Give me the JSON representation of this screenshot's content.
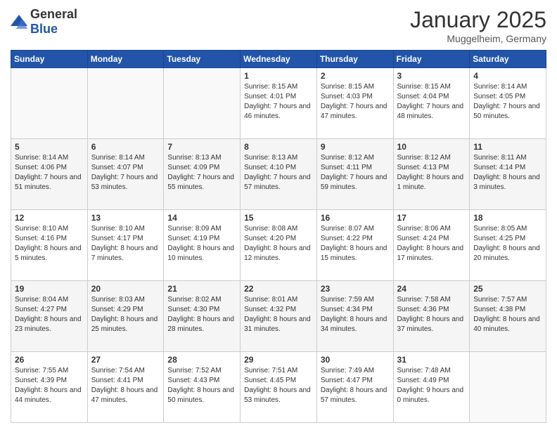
{
  "header": {
    "logo_general": "General",
    "logo_blue": "Blue",
    "month_title": "January 2025",
    "location": "Muggelheim, Germany"
  },
  "days_of_week": [
    "Sunday",
    "Monday",
    "Tuesday",
    "Wednesday",
    "Thursday",
    "Friday",
    "Saturday"
  ],
  "weeks": [
    [
      {
        "day": "",
        "info": ""
      },
      {
        "day": "",
        "info": ""
      },
      {
        "day": "",
        "info": ""
      },
      {
        "day": "1",
        "info": "Sunrise: 8:15 AM\nSunset: 4:01 PM\nDaylight: 7 hours and 46 minutes."
      },
      {
        "day": "2",
        "info": "Sunrise: 8:15 AM\nSunset: 4:03 PM\nDaylight: 7 hours and 47 minutes."
      },
      {
        "day": "3",
        "info": "Sunrise: 8:15 AM\nSunset: 4:04 PM\nDaylight: 7 hours and 48 minutes."
      },
      {
        "day": "4",
        "info": "Sunrise: 8:14 AM\nSunset: 4:05 PM\nDaylight: 7 hours and 50 minutes."
      }
    ],
    [
      {
        "day": "5",
        "info": "Sunrise: 8:14 AM\nSunset: 4:06 PM\nDaylight: 7 hours and 51 minutes."
      },
      {
        "day": "6",
        "info": "Sunrise: 8:14 AM\nSunset: 4:07 PM\nDaylight: 7 hours and 53 minutes."
      },
      {
        "day": "7",
        "info": "Sunrise: 8:13 AM\nSunset: 4:09 PM\nDaylight: 7 hours and 55 minutes."
      },
      {
        "day": "8",
        "info": "Sunrise: 8:13 AM\nSunset: 4:10 PM\nDaylight: 7 hours and 57 minutes."
      },
      {
        "day": "9",
        "info": "Sunrise: 8:12 AM\nSunset: 4:11 PM\nDaylight: 7 hours and 59 minutes."
      },
      {
        "day": "10",
        "info": "Sunrise: 8:12 AM\nSunset: 4:13 PM\nDaylight: 8 hours and 1 minute."
      },
      {
        "day": "11",
        "info": "Sunrise: 8:11 AM\nSunset: 4:14 PM\nDaylight: 8 hours and 3 minutes."
      }
    ],
    [
      {
        "day": "12",
        "info": "Sunrise: 8:10 AM\nSunset: 4:16 PM\nDaylight: 8 hours and 5 minutes."
      },
      {
        "day": "13",
        "info": "Sunrise: 8:10 AM\nSunset: 4:17 PM\nDaylight: 8 hours and 7 minutes."
      },
      {
        "day": "14",
        "info": "Sunrise: 8:09 AM\nSunset: 4:19 PM\nDaylight: 8 hours and 10 minutes."
      },
      {
        "day": "15",
        "info": "Sunrise: 8:08 AM\nSunset: 4:20 PM\nDaylight: 8 hours and 12 minutes."
      },
      {
        "day": "16",
        "info": "Sunrise: 8:07 AM\nSunset: 4:22 PM\nDaylight: 8 hours and 15 minutes."
      },
      {
        "day": "17",
        "info": "Sunrise: 8:06 AM\nSunset: 4:24 PM\nDaylight: 8 hours and 17 minutes."
      },
      {
        "day": "18",
        "info": "Sunrise: 8:05 AM\nSunset: 4:25 PM\nDaylight: 8 hours and 20 minutes."
      }
    ],
    [
      {
        "day": "19",
        "info": "Sunrise: 8:04 AM\nSunset: 4:27 PM\nDaylight: 8 hours and 23 minutes."
      },
      {
        "day": "20",
        "info": "Sunrise: 8:03 AM\nSunset: 4:29 PM\nDaylight: 8 hours and 25 minutes."
      },
      {
        "day": "21",
        "info": "Sunrise: 8:02 AM\nSunset: 4:30 PM\nDaylight: 8 hours and 28 minutes."
      },
      {
        "day": "22",
        "info": "Sunrise: 8:01 AM\nSunset: 4:32 PM\nDaylight: 8 hours and 31 minutes."
      },
      {
        "day": "23",
        "info": "Sunrise: 7:59 AM\nSunset: 4:34 PM\nDaylight: 8 hours and 34 minutes."
      },
      {
        "day": "24",
        "info": "Sunrise: 7:58 AM\nSunset: 4:36 PM\nDaylight: 8 hours and 37 minutes."
      },
      {
        "day": "25",
        "info": "Sunrise: 7:57 AM\nSunset: 4:38 PM\nDaylight: 8 hours and 40 minutes."
      }
    ],
    [
      {
        "day": "26",
        "info": "Sunrise: 7:55 AM\nSunset: 4:39 PM\nDaylight: 8 hours and 44 minutes."
      },
      {
        "day": "27",
        "info": "Sunrise: 7:54 AM\nSunset: 4:41 PM\nDaylight: 8 hours and 47 minutes."
      },
      {
        "day": "28",
        "info": "Sunrise: 7:52 AM\nSunset: 4:43 PM\nDaylight: 8 hours and 50 minutes."
      },
      {
        "day": "29",
        "info": "Sunrise: 7:51 AM\nSunset: 4:45 PM\nDaylight: 8 hours and 53 minutes."
      },
      {
        "day": "30",
        "info": "Sunrise: 7:49 AM\nSunset: 4:47 PM\nDaylight: 8 hours and 57 minutes."
      },
      {
        "day": "31",
        "info": "Sunrise: 7:48 AM\nSunset: 4:49 PM\nDaylight: 9 hours and 0 minutes."
      },
      {
        "day": "",
        "info": ""
      }
    ]
  ]
}
